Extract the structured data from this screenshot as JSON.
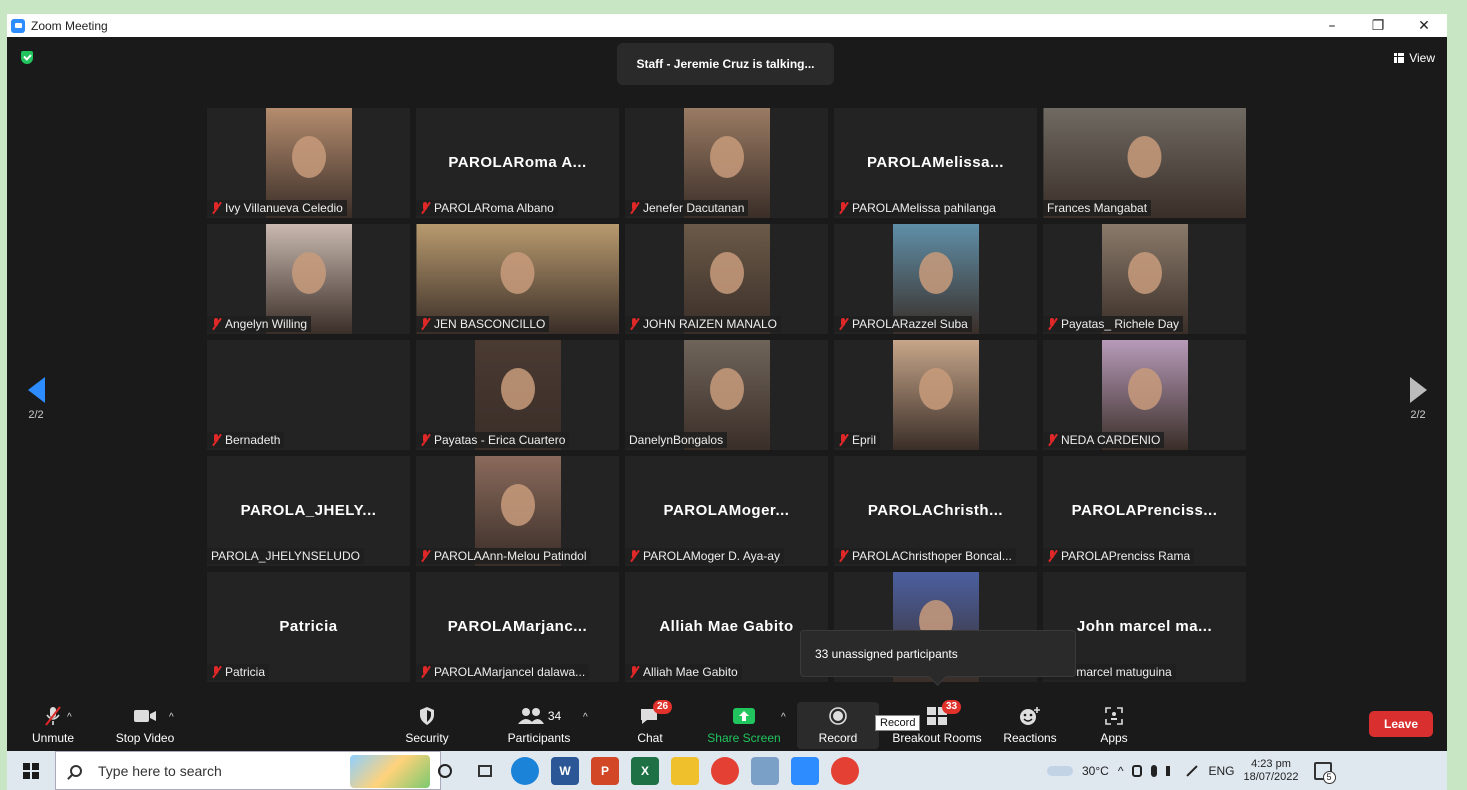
{
  "window": {
    "title": "Zoom Meeting",
    "minimize": "–",
    "restore": "❐",
    "close": "✕"
  },
  "meeting": {
    "talking": "Staff - Jeremie Cruz is talking...",
    "view_label": "View",
    "page_left": "2/2",
    "page_right": "2/2",
    "unassigned": "33 unassigned participants",
    "colors": {
      "accent": "#2d8cff",
      "leave": "#d92f2f",
      "badge": "#e0312b",
      "mute": "#e02828"
    }
  },
  "tiles": [
    {
      "name": "Ivy Villanueva Celedio",
      "muted": true,
      "video": true,
      "photo": "#b58c6e"
    },
    {
      "name": "PAROLARoma Albano",
      "muted": true,
      "big": "PAROLARoma A..."
    },
    {
      "name": "Jenefer Dacutanan",
      "muted": true,
      "video": true,
      "photo": "#9a7b63"
    },
    {
      "name": "PAROLAMelissa pahilanga",
      "muted": true,
      "big": "PAROLAMelissa..."
    },
    {
      "name": "Frances Mangabat",
      "muted": false,
      "video": true,
      "photo": "#6f6a62",
      "wide": true
    },
    {
      "name": "Angelyn Willing",
      "muted": true,
      "video": true,
      "photo": "#c9b9b0"
    },
    {
      "name": "JEN BASCONCILLO",
      "muted": true,
      "video": true,
      "photo": "#b89a6e",
      "wide": true
    },
    {
      "name": "JOHN RAIZEN MANALO",
      "muted": true,
      "video": true,
      "photo": "#6b5a48"
    },
    {
      "name": "PAROLARazzel Suba",
      "muted": true,
      "video": true,
      "photo": "#5f8fa8"
    },
    {
      "name": "Payatas_ Richele Day",
      "muted": true,
      "video": true,
      "photo": "#8a7a6a"
    },
    {
      "name": "Bernadeth",
      "muted": true
    },
    {
      "name": "Payatas - Erica Cuartero",
      "muted": true,
      "video": true,
      "photo": "#4a3a32"
    },
    {
      "name": "DanelynBongalos",
      "muted": false,
      "video": true,
      "photo": "#6f645a"
    },
    {
      "name": "Epril",
      "muted": true,
      "video": true,
      "photo": "#c7a68a"
    },
    {
      "name": "NEDA CARDENIO",
      "muted": true,
      "video": true,
      "photo": "#b79ab9"
    },
    {
      "name": "PAROLA_JHELYNSELUDO",
      "muted": false,
      "big": "PAROLA_JHELY..."
    },
    {
      "name": "PAROLAAnn-Melou Patindol",
      "muted": true,
      "video": true,
      "photo": "#8a6a5c"
    },
    {
      "name": "PAROLAMoger  D. Aya-ay",
      "muted": true,
      "big": "PAROLAMoger..."
    },
    {
      "name": "PAROLAChristhoper Boncal...",
      "muted": true,
      "big": "PAROLAChristh..."
    },
    {
      "name": "PAROLAPrenciss Rama",
      "muted": true,
      "big": "PAROLAPrenciss..."
    },
    {
      "name": "Patricia",
      "muted": true,
      "big": "Patricia"
    },
    {
      "name": "PAROLAMarjancel  dalawa...",
      "muted": true,
      "big": "PAROLAMarjanc..."
    },
    {
      "name": "Alliah Mae Gabito",
      "muted": true,
      "big": "Alliah Mae Gabito"
    },
    {
      "name": "",
      "muted": false,
      "video": true,
      "photo": "#4b5fa0"
    },
    {
      "name": "John marcel matuguina",
      "muted": false,
      "big": "John marcel ma..."
    }
  ],
  "toolbar": {
    "unmute": "Unmute",
    "stop_video": "Stop Video",
    "security": "Security",
    "participants": "Participants",
    "participants_count": "34",
    "chat": "Chat",
    "chat_badge": "26",
    "share_screen": "Share Screen",
    "record": "Record",
    "record_tooltip": "Record",
    "breakout_rooms": "Breakout Rooms",
    "breakout_badge": "33",
    "reactions": "Reactions",
    "apps": "Apps",
    "leave": "Leave",
    "caret": "^"
  },
  "taskbar": {
    "search_placeholder": "Type here to search",
    "temperature": "30°C",
    "language": "ENG",
    "time": "4:23 pm",
    "date": "18/07/2022",
    "notifications": "5",
    "tray_caret": "^"
  }
}
